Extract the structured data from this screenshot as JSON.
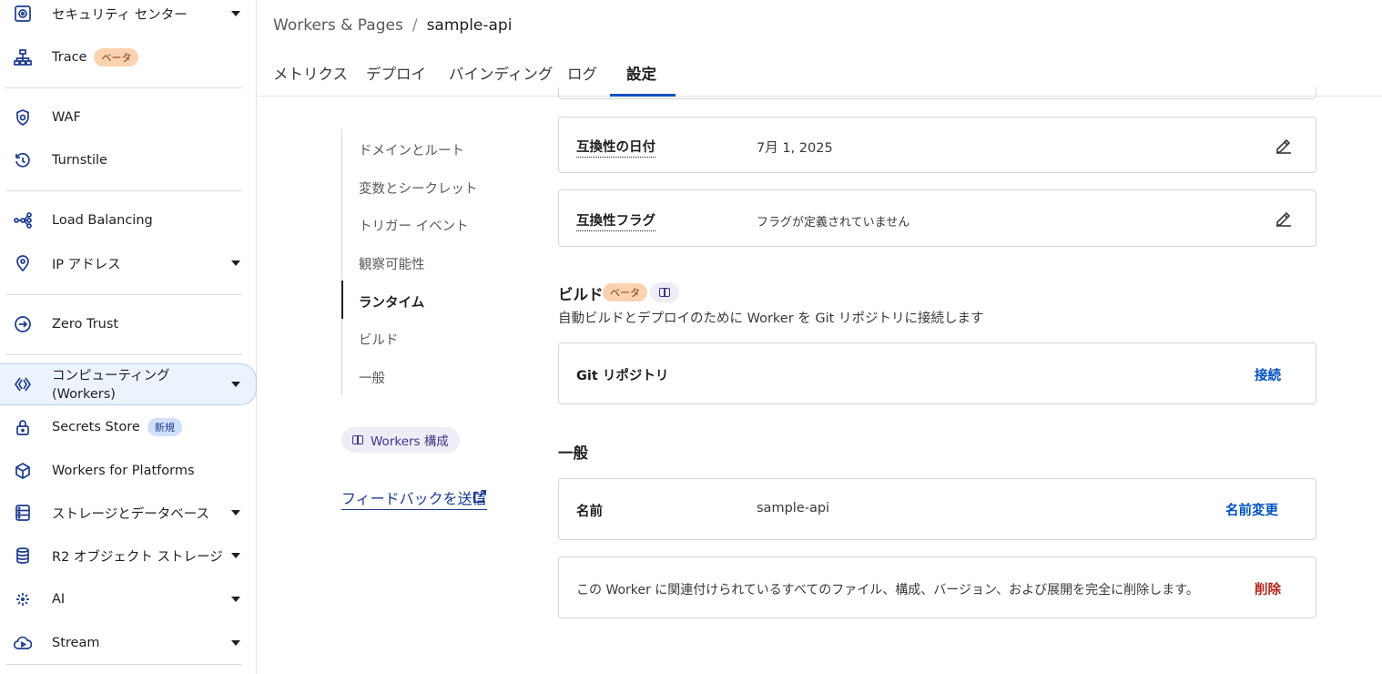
{
  "sidebar": {
    "items": [
      {
        "label": "セキュリティ センター",
        "icon": "security-center-icon"
      },
      {
        "label": "Trace",
        "badge": "ベータ",
        "icon": "trace-icon"
      },
      {
        "label": "WAF",
        "icon": "waf-icon"
      },
      {
        "label": "Turnstile",
        "icon": "turnstile-icon"
      },
      {
        "label": "Load Balancing",
        "icon": "load-balancing-icon"
      },
      {
        "label": "IP アドレス",
        "icon": "location-pin-icon"
      },
      {
        "label": "Zero Trust",
        "icon": "zero-trust-icon"
      },
      {
        "label_line1": "コンピューティング",
        "label_line2": "(Workers)",
        "icon": "workers-icon"
      },
      {
        "label": "Secrets Store",
        "badge": "新規",
        "icon": "lock-icon"
      },
      {
        "label": "Workers for Platforms",
        "icon": "cube-icon"
      },
      {
        "label": "ストレージとデータベース",
        "icon": "database-icon"
      },
      {
        "label": "R2 オブジェクト ストレージ",
        "icon": "r2-storage-icon"
      },
      {
        "label": "AI",
        "icon": "sparkle-icon"
      },
      {
        "label": "Stream",
        "icon": "cloud-play-icon"
      }
    ]
  },
  "header": {
    "breadcrumb_parent": "Workers & Pages",
    "breadcrumb_sep": "/",
    "breadcrumb_current": "sample-api",
    "tabs": [
      "メトリクス",
      "デプロイ",
      "バインディング",
      "ログ",
      "設定"
    ],
    "active_tab": "設定"
  },
  "subnav": {
    "items": [
      "ドメインとルート",
      "変数とシークレット",
      "トリガー イベント",
      "観察可能性",
      "ランタイム",
      "ビルド",
      "一般"
    ],
    "active": "ランタイム",
    "docs_pill": "Workers 構成",
    "feedback": "フィードバックを送信"
  },
  "runtime": {
    "compat_date_key": "互換性の日付",
    "compat_date_value": "7月 1, 2025",
    "compat_flags_key": "互換性フラグ",
    "compat_flags_value": "フラグが定義されていません"
  },
  "build": {
    "title": "ビルド",
    "badge": "ベータ",
    "subtitle": "自動ビルドとデプロイのために Worker を Git リポジトリに接続します",
    "git_key": "Git リポジトリ",
    "connect_label": "接続"
  },
  "general": {
    "title": "一般",
    "name_key": "名前",
    "name_value": "sample-api",
    "rename_label": "名前変更",
    "delete_desc": "この Worker に関連付けられているすべてのファイル、構成、バージョン、および展開を完全に削除します。",
    "delete_label": "削除"
  },
  "colors": {
    "accent": "#0051c3",
    "danger": "#b3251d",
    "sidebar_icon": "#1d3a8f"
  }
}
